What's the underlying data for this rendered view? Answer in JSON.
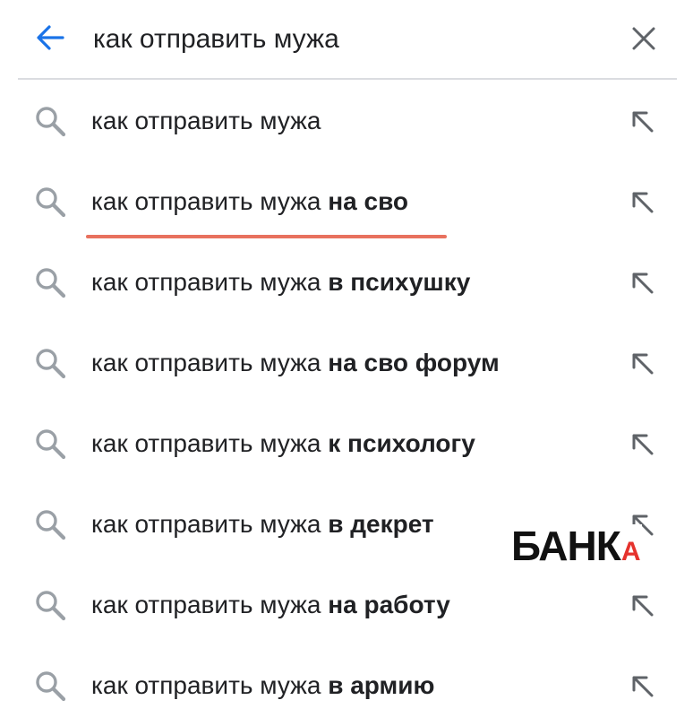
{
  "search": {
    "query": "как отправить мужа"
  },
  "icons": {
    "back": "arrow-left-icon",
    "clear": "close-icon",
    "suggestion": "search-icon",
    "fill": "arrow-up-left-icon"
  },
  "colors": {
    "back_arrow": "#1a73e8",
    "text": "#202124",
    "icon_gray": "#9aa0a6",
    "underline": "#e8715e",
    "watermark_black": "#111111",
    "watermark_red": "#e5322d"
  },
  "suggestions": [
    {
      "prefix": "как отправить мужа",
      "completion": ""
    },
    {
      "prefix": "как отправить мужа",
      "completion": "на сво"
    },
    {
      "prefix": "как отправить мужа",
      "completion": "в психушку"
    },
    {
      "prefix": "как отправить мужа",
      "completion": "на сво форум"
    },
    {
      "prefix": "как отправить мужа",
      "completion": "к психологу"
    },
    {
      "prefix": "как отправить мужа",
      "completion": "в декрет"
    },
    {
      "prefix": "как отправить мужа",
      "completion": "на работу"
    },
    {
      "prefix": "как отправить мужа",
      "completion": "в армию"
    }
  ],
  "watermark": {
    "main": "БАНК",
    "accent": "А"
  }
}
